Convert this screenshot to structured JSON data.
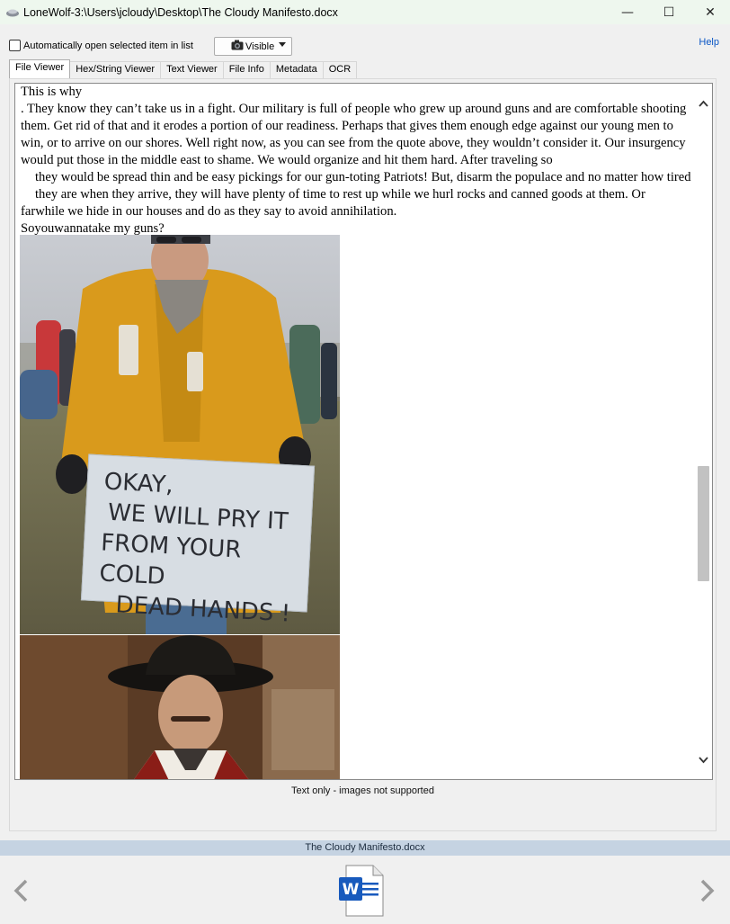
{
  "window": {
    "title": "LoneWolf-3:\\Users\\jcloudy\\Desktop\\The Cloudy Manifesto.docx",
    "minimize_glyph": "—",
    "maximize_glyph": "☐",
    "close_glyph": "✕"
  },
  "toolbar": {
    "auto_open_label": "Automatically open selected item in list",
    "auto_open_checked": false,
    "visibility_dropdown": "Visible",
    "help_label": "Help"
  },
  "tabs": [
    {
      "label": "File Viewer",
      "active": true
    },
    {
      "label": "Hex/String Viewer",
      "active": false
    },
    {
      "label": "Text Viewer",
      "active": false
    },
    {
      "label": "File Info",
      "active": false
    },
    {
      "label": "Metadata",
      "active": false
    },
    {
      "label": "OCR",
      "active": false
    }
  ],
  "document": {
    "line1": "This is why",
    "paragraph1": ". They know they can’t take us in a fight. Our military is full of people who grew up around guns and are comfortable shooting them. Get rid of that and it erodes a portion of our readiness. Perhaps that gives them enough edge against our young men to win, or to arrive on our shores. Well right now, as you can see from the quote above, they wouldn’t consider it. Our insurgency would put those in the middle east to shame. We would organize and hit them hard. After traveling so",
    "paragraph2": "they would be spread thin and be easy pickings for our gun-toting Patriots! But, disarm the populace and no matter how tired they are when they arrive, they will have plenty of time to rest up while we hurl rocks and canned goods at them. Or",
    "paragraph3": "farwhile we hide in our houses and do as they say to avoid annihilation.",
    "line_last": "Soyouwannatake my guns?",
    "sign_line1": "OKAY,",
    "sign_line2": "WE WILL PRY IT",
    "sign_line3": "FROM YOUR COLD",
    "sign_line4": "DEAD  HANDS !"
  },
  "viewer_status": "Text only - images not supported",
  "footer": {
    "filename": "The Cloudy Manifesto.docx",
    "file_icon": "word-doc-icon"
  },
  "colors": {
    "titlebar_bg": "#eef7ee",
    "footer_bar_bg": "#c5d3e2",
    "help_link": "#0b57c5",
    "word_blue": "#185abd"
  }
}
